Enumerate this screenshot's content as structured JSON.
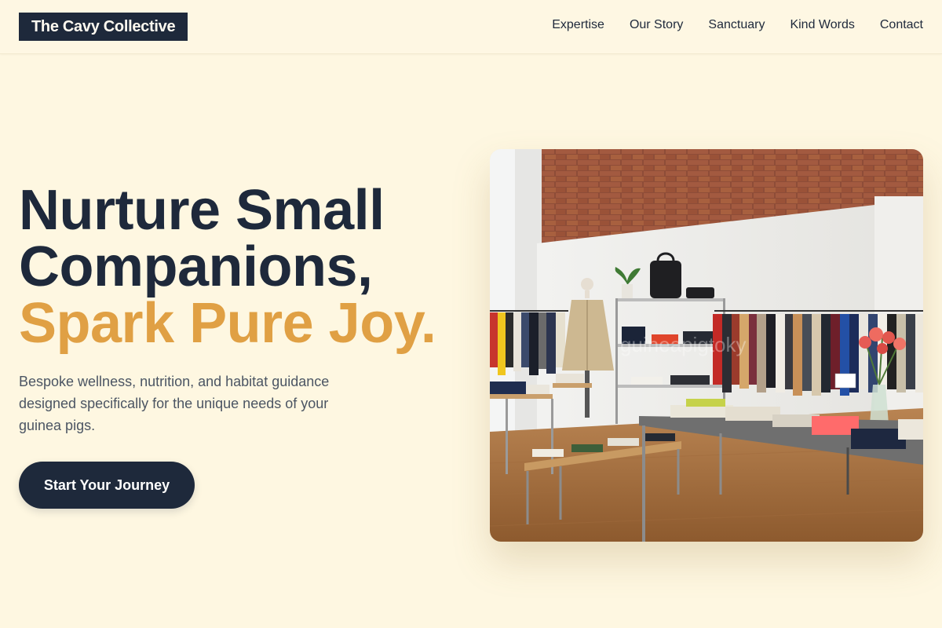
{
  "brand": {
    "name": "The Cavy Collective"
  },
  "nav": {
    "items": [
      {
        "label": "Expertise"
      },
      {
        "label": "Our Story"
      },
      {
        "label": "Sanctuary"
      },
      {
        "label": "Kind Words"
      },
      {
        "label": "Contact"
      }
    ]
  },
  "hero": {
    "title_line1": "Nurture Small",
    "title_line2": "Companions,",
    "title_accent": "Spark Pure Joy.",
    "subtitle": "Bespoke wellness, nutrition, and habitat guidance designed specifically for the unique needs of your guinea pigs.",
    "cta_label": "Start Your Journey",
    "image_watermark": "guineapigtoky"
  },
  "colors": {
    "background": "#fef7e1",
    "navy": "#1e293b",
    "accent": "#e0a044",
    "body_text": "#4b5563"
  }
}
